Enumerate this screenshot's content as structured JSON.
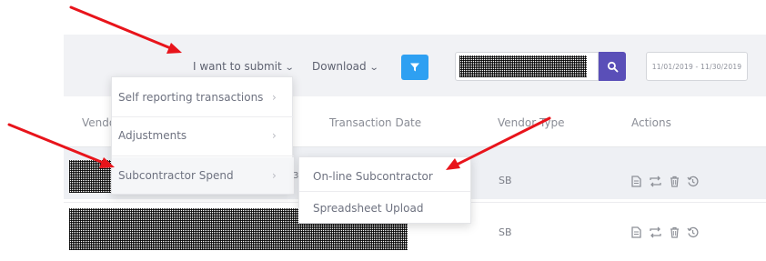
{
  "toolbar": {
    "submit_label": "I want to submit",
    "download_label": "Download",
    "filter_icon": "funnel-icon",
    "search_icon": "magnifier-icon",
    "date_range": "11/01/2019 - 11/30/2019"
  },
  "table": {
    "columns": [
      "Vendor",
      "Transaction Date",
      "Vendor Type",
      "Actions"
    ],
    "rows": [
      {
        "vendor_type": "SB"
      },
      {
        "vendor_type": "SB"
      }
    ],
    "action_icons": [
      "document-icon",
      "swap-icon",
      "trash-icon",
      "history-icon"
    ]
  },
  "submit_menu": {
    "items": [
      {
        "label": "Self reporting transactions"
      },
      {
        "label": "Adjustments"
      },
      {
        "label": "Subcontractor Spend"
      }
    ],
    "submenu": [
      {
        "label": "On-line Subcontractor"
      },
      {
        "label": "Spreadsheet Upload"
      }
    ]
  },
  "row_partial_text": "3.",
  "colors": {
    "toolbar_bg": "#f1f2f5",
    "filter_button": "#2ea0f2",
    "search_button": "#5a4fb8",
    "annotation_arrow": "#e8141b",
    "highlight_row": "#eef0f4"
  }
}
